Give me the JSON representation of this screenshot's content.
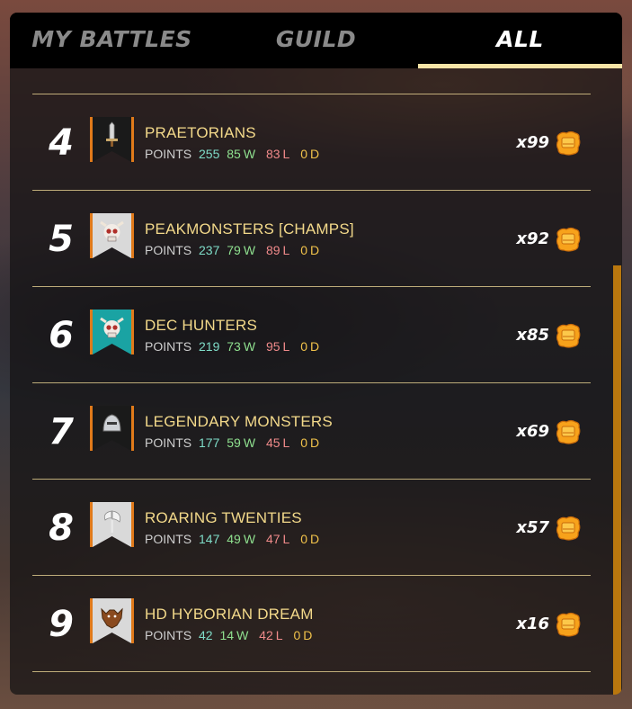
{
  "tabs": [
    {
      "label": "MY BATTLES",
      "active": false
    },
    {
      "label": "GUILD",
      "active": false
    },
    {
      "label": "ALL",
      "active": true
    }
  ],
  "stats_labels": {
    "points": "POINTS",
    "w": "W",
    "l": "L",
    "d": "D"
  },
  "colors": {
    "name": "#f3d98a",
    "points": "#7fdcc8",
    "wins": "#8fe08f",
    "losses": "#f08a8a",
    "draws": "#f0c24a",
    "tab_underline": "#f6e4a6",
    "scrollbar": "#b9770e"
  },
  "rows": [
    {
      "rank": "4",
      "name": "PRAETORIANS",
      "points": "255",
      "w": "85",
      "l": "83",
      "d": "0",
      "multiplier": "x99",
      "banner_icon": "sword-icon",
      "banner_color": "#1a1a1a"
    },
    {
      "rank": "5",
      "name": "PEAKMONSTERS [CHAMPS]",
      "points": "237",
      "w": "79",
      "l": "89",
      "d": "0",
      "multiplier": "x92",
      "banner_icon": "skull-icon",
      "banner_color": "#d9d9d9"
    },
    {
      "rank": "6",
      "name": "DEC HUNTERS",
      "points": "219",
      "w": "73",
      "l": "95",
      "d": "0",
      "multiplier": "x85",
      "banner_icon": "skull-icon",
      "banner_color": "#1aa3a3"
    },
    {
      "rank": "7",
      "name": "LEGENDARY MONSTERS",
      "points": "177",
      "w": "59",
      "l": "45",
      "d": "0",
      "multiplier": "x69",
      "banner_icon": "helmet-icon",
      "banner_color": "#1a1a1a"
    },
    {
      "rank": "8",
      "name": "ROARING TWENTIES",
      "points": "147",
      "w": "49",
      "l": "47",
      "d": "0",
      "multiplier": "x57",
      "banner_icon": "axe-icon",
      "banner_color": "#d9d9d9"
    },
    {
      "rank": "9",
      "name": "HD HYBORIAN DREAM",
      "points": "42",
      "w": "14",
      "l": "42",
      "d": "0",
      "multiplier": "x16",
      "banner_icon": "wolf-icon",
      "banner_color": "#d9d9d9"
    }
  ],
  "reward_icon": "gold-chest-icon"
}
